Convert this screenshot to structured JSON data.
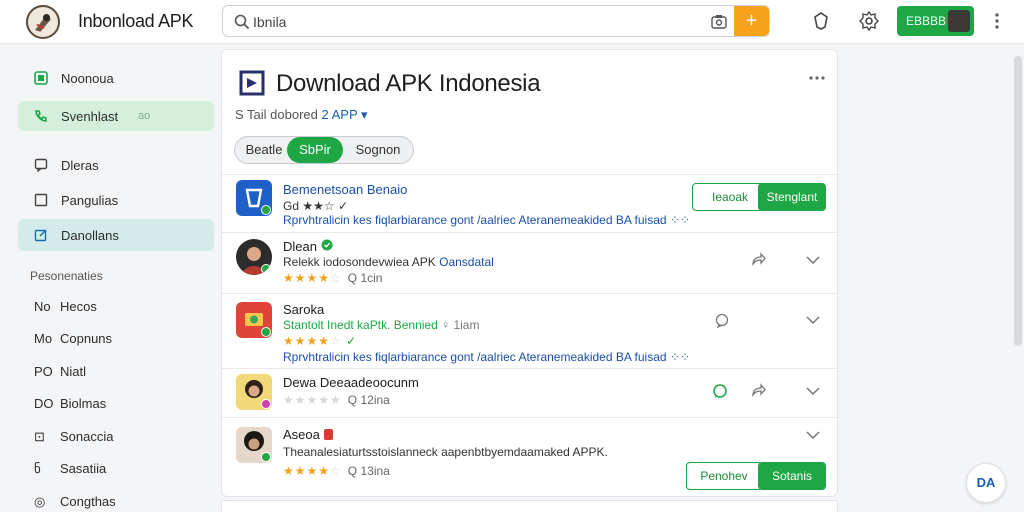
{
  "header": {
    "app_title": "Inbonload APK",
    "search_value": "Ibnila",
    "add_label": "+",
    "user_button_label": "EBBBB"
  },
  "sidebar": {
    "items": [
      {
        "label": "Noonoua"
      },
      {
        "label": "Svenhlast",
        "hint": "ao"
      },
      {
        "label": "Dleras"
      },
      {
        "label": "Pangulias"
      },
      {
        "label": "Danollans"
      }
    ],
    "section_heading": "Pesonenaties",
    "sub_items": [
      {
        "prefix": "No",
        "label": "Hecos"
      },
      {
        "prefix": "Mo",
        "label": "Copnuns"
      },
      {
        "prefix": "PO",
        "label": "Niatl"
      },
      {
        "prefix": "DO",
        "label": "Biolmas"
      },
      {
        "prefix": "⊡",
        "label": "Sonaccia"
      },
      {
        "prefix": "ნ",
        "label": "Sasatiia"
      },
      {
        "prefix": "◎",
        "label": "Congthas"
      }
    ]
  },
  "card": {
    "title": "Download APK Indonesia",
    "subtitle_prefix": "S Tail dobored",
    "subtitle_accent": "2 APP",
    "subtitle_arrow": "▾",
    "pills": [
      "Beatle",
      "SbPir",
      "Sognon"
    ],
    "rows": [
      {
        "name": "Bemenetsoan Benaio",
        "line2": "Gd ★★☆ ✓",
        "line3": "Rprvhtralicin kes fiqlarbiarance gont /aalriec Ateranemeakided",
        "line3_tag": "BA fuisad ⁘⁘",
        "btn_outline": "Ieaoak",
        "btn_solid": "Stenglant"
      },
      {
        "name": "Dlean",
        "line2": "Relekk iodosondevwiea APK",
        "line2_tag": "Oansdatal",
        "stars_meta": "Q 1cin"
      },
      {
        "name": "Saroka",
        "line2": "Stantolt Inedt kaPtk. Bennied",
        "line2_meta": "♀ 1iam",
        "stars_meta": "",
        "line3": "Rprvhtralicin kes fiqlarbiarance gont /aalriec Ateranemeakided",
        "line3_tag": "BA fuisad ⁘⁘"
      },
      {
        "name": "Dewa Deeaadeoocunm",
        "stars_meta": "Q 12ina"
      },
      {
        "name": "Aseoa",
        "line2": "Theanalesiaturtsstoislanneck aapenbtbyemdaamaked APPK.",
        "stars_meta": "Q 13ina",
        "btn_outline": "Penohev",
        "btn_solid": "Sotanis"
      }
    ]
  },
  "fab_label": "DA",
  "colors": {
    "brand_green": "#1fa746",
    "accent_orange": "#f7a21b",
    "link_blue": "#1a4fa8",
    "star": "#f2a21a"
  }
}
